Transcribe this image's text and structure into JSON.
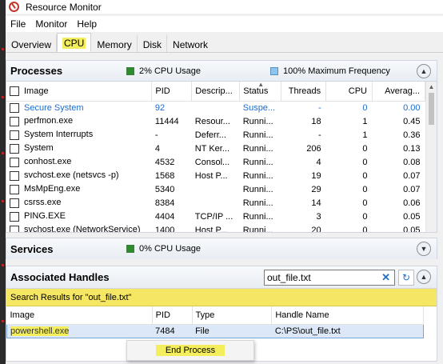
{
  "window": {
    "title": "Resource Monitor"
  },
  "menu": [
    "File",
    "Monitor",
    "Help"
  ],
  "tabs": [
    "Overview",
    "CPU",
    "Memory",
    "Disk",
    "Network"
  ],
  "processes": {
    "title": "Processes",
    "cpu_usage": "2% CPU Usage",
    "max_freq": "100% Maximum Frequency",
    "columns": [
      "Image",
      "PID",
      "Descrip...",
      "Status",
      "Threads",
      "CPU",
      "Averag..."
    ],
    "rows": [
      [
        "Secure System",
        "92",
        "",
        "Suspe...",
        "-",
        "0",
        "0.00"
      ],
      [
        "perfmon.exe",
        "11444",
        "Resour...",
        "Runni...",
        "18",
        "1",
        "0.45"
      ],
      [
        "System Interrupts",
        "-",
        "Deferr...",
        "Runni...",
        "-",
        "1",
        "0.36"
      ],
      [
        "System",
        "4",
        "NT Ker...",
        "Runni...",
        "206",
        "0",
        "0.13"
      ],
      [
        "conhost.exe",
        "4532",
        "Consol...",
        "Runni...",
        "4",
        "0",
        "0.08"
      ],
      [
        "svchost.exe (netsvcs -p)",
        "1568",
        "Host P...",
        "Runni...",
        "19",
        "0",
        "0.07"
      ],
      [
        "MsMpEng.exe",
        "5340",
        "",
        "Runni...",
        "29",
        "0",
        "0.07"
      ],
      [
        "csrss.exe",
        "8384",
        "",
        "Runni...",
        "14",
        "0",
        "0.06"
      ],
      [
        "PING.EXE",
        "4404",
        "TCP/IP ...",
        "Runni...",
        "3",
        "0",
        "0.05"
      ],
      [
        "svchost.exe (NetworkService)",
        "1400",
        "Host P...",
        "Runni...",
        "20",
        "0",
        "0.05"
      ]
    ]
  },
  "services": {
    "title": "Services",
    "cpu_usage": "0% CPU Usage"
  },
  "handles": {
    "title": "Associated Handles",
    "search_value": "out_file.txt",
    "results_label": "Search Results for \"out_file.txt\"",
    "columns": [
      "Image",
      "PID",
      "Type",
      "Handle Name"
    ],
    "rows": [
      [
        "powershell.exe",
        "7484",
        "File",
        "C:\\PS\\out_file.txt"
      ]
    ]
  },
  "context_menu": {
    "item": "End Process"
  },
  "colors": {
    "highlight": "#f4ee5c",
    "accent": "#1f6fcf",
    "selection": "#dce8f7"
  },
  "icons": [
    "resource-monitor-icon",
    "chevron-up-icon",
    "chevron-down-icon",
    "clear-icon",
    "refresh-icon"
  ]
}
